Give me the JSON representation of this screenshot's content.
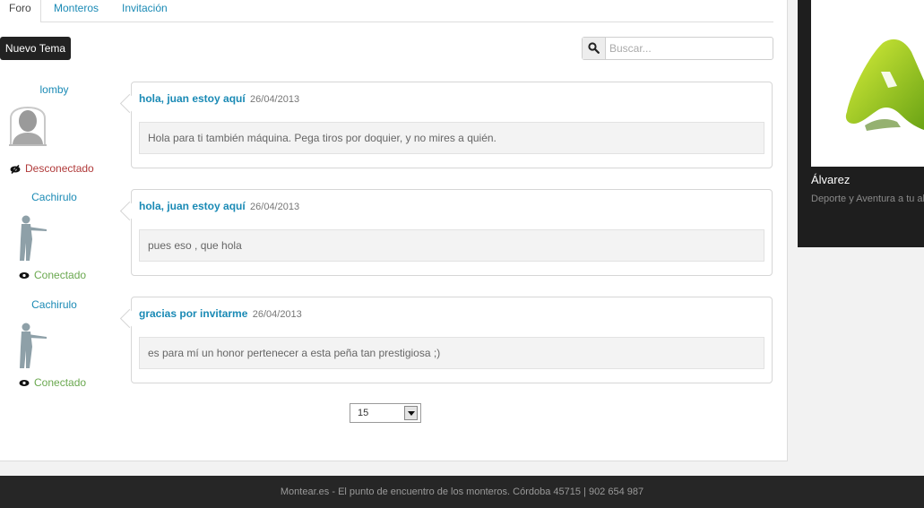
{
  "tabs": [
    {
      "label": "Foro",
      "active": true
    },
    {
      "label": "Monteros",
      "active": false
    },
    {
      "label": "Invitación",
      "active": false
    }
  ],
  "toolbar": {
    "new_topic_label": "Nuevo Tema",
    "search_placeholder": "Buscar...",
    "search_icon": "search-icon"
  },
  "posts": [
    {
      "author": "lomby",
      "avatar": "default-avatar",
      "status": "Desconectado",
      "status_icon": "eye-slash-icon",
      "title": "hola, juan estoy aquí",
      "date": "26/04/2013",
      "body": "Hola para ti también máquina. Pega tiros por doquier, y no mires a quién."
    },
    {
      "author": "Cachirulo",
      "avatar": "hunter-silhouette",
      "status": "Conectado",
      "status_icon": "eye-icon",
      "title": "hola, juan estoy aquí",
      "date": "26/04/2013",
      "body": "pues eso , que hola"
    },
    {
      "author": "Cachirulo",
      "avatar": "hunter-silhouette",
      "status": "Conectado",
      "status_icon": "eye-icon",
      "title": "gracias por invitarme",
      "date": "26/04/2013",
      "body": "es para mí un honor pertenecer a esta peña tan prestigiosa ;)"
    }
  ],
  "pagination": {
    "per_page": "15"
  },
  "ad": {
    "title": "Álvarez",
    "subtitle": "Deporte y Aventura a tu al",
    "logo_icon": "green-a-logo"
  },
  "footer": {
    "text": "Montear.es - El punto de encuentro de los monteros. Córdoba 45715 | 902 654 987"
  },
  "colors": {
    "link": "#1a8ab5",
    "offline": "#b03a3a",
    "online": "#6aa84f",
    "dark": "#222222",
    "footer_bg": "#262626"
  }
}
